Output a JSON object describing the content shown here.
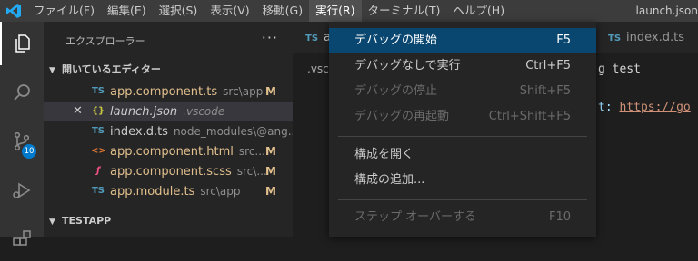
{
  "menubar": {
    "items": [
      {
        "label": "ファイル(F)"
      },
      {
        "label": "編集(E)"
      },
      {
        "label": "選択(S)"
      },
      {
        "label": "表示(V)"
      },
      {
        "label": "移動(G)"
      },
      {
        "label": "実行(R)",
        "active": true
      },
      {
        "label": "ターミナル(T)"
      },
      {
        "label": "ヘルプ(H)"
      }
    ],
    "window_title": "launch.json"
  },
  "activitybar": {
    "icons": [
      "explorer-icon",
      "search-icon",
      "source-control-icon",
      "run-debug-icon",
      "extensions-icon"
    ],
    "scm_badge": "10"
  },
  "sidebar": {
    "title": "エクスプローラー",
    "more": "···",
    "open_editors": {
      "title": "開いているエディター",
      "files": [
        {
          "icon": "TS",
          "name": "app.component.ts",
          "path": "src\\app",
          "status": "M",
          "modified": true
        },
        {
          "icon": "{}",
          "name": "launch.json",
          "path": ".vscode",
          "status": "",
          "modified": false,
          "selected": true,
          "italic": true
        },
        {
          "icon": "TS",
          "name": "index.d.ts",
          "path": "node_modules\\@ang...",
          "status": "",
          "modified": false
        },
        {
          "icon": "<>",
          "name": "app.component.html",
          "path": "src...",
          "status": "M",
          "modified": true
        },
        {
          "icon": "ƒ",
          "name": "app.component.scss",
          "path": "src\\...",
          "status": "M",
          "modified": true
        },
        {
          "icon": "TS",
          "name": "app.module.ts",
          "path": "src\\app",
          "status": "M",
          "modified": true
        }
      ]
    },
    "workspace": {
      "title": "TESTAPP"
    }
  },
  "editor": {
    "tabs": [
      {
        "icon": "TS",
        "name": "a"
      },
      {
        "icon": "TS",
        "name": "index.d.ts"
      }
    ],
    "breadcrumb": ".vsc",
    "lines": [
      {
        "text": "g test",
        "kind": "plain"
      },
      {
        "key": "t:",
        "value": "https://go"
      }
    ]
  },
  "run_menu": {
    "items": [
      {
        "label": "デバッグの開始",
        "shortcut": "F5",
        "state": "highlight"
      },
      {
        "label": "デバッグなしで実行",
        "shortcut": "Ctrl+F5",
        "state": "enabled"
      },
      {
        "label": "デバッグの停止",
        "shortcut": "Shift+F5",
        "state": "disabled"
      },
      {
        "label": "デバッグの再起動",
        "shortcut": "Ctrl+Shift+F5",
        "state": "disabled"
      },
      {
        "label": "構成を開く",
        "shortcut": "",
        "state": "enabled"
      },
      {
        "label": "構成の追加...",
        "shortcut": "",
        "state": "enabled"
      },
      {
        "label": "ステップ オーバーする",
        "shortcut": "F10",
        "state": "disabled"
      }
    ]
  },
  "colors": {
    "accent": "#007acc",
    "highlight": "#094771",
    "modified": "#e2c08d",
    "ts_blue": "#519aba"
  }
}
